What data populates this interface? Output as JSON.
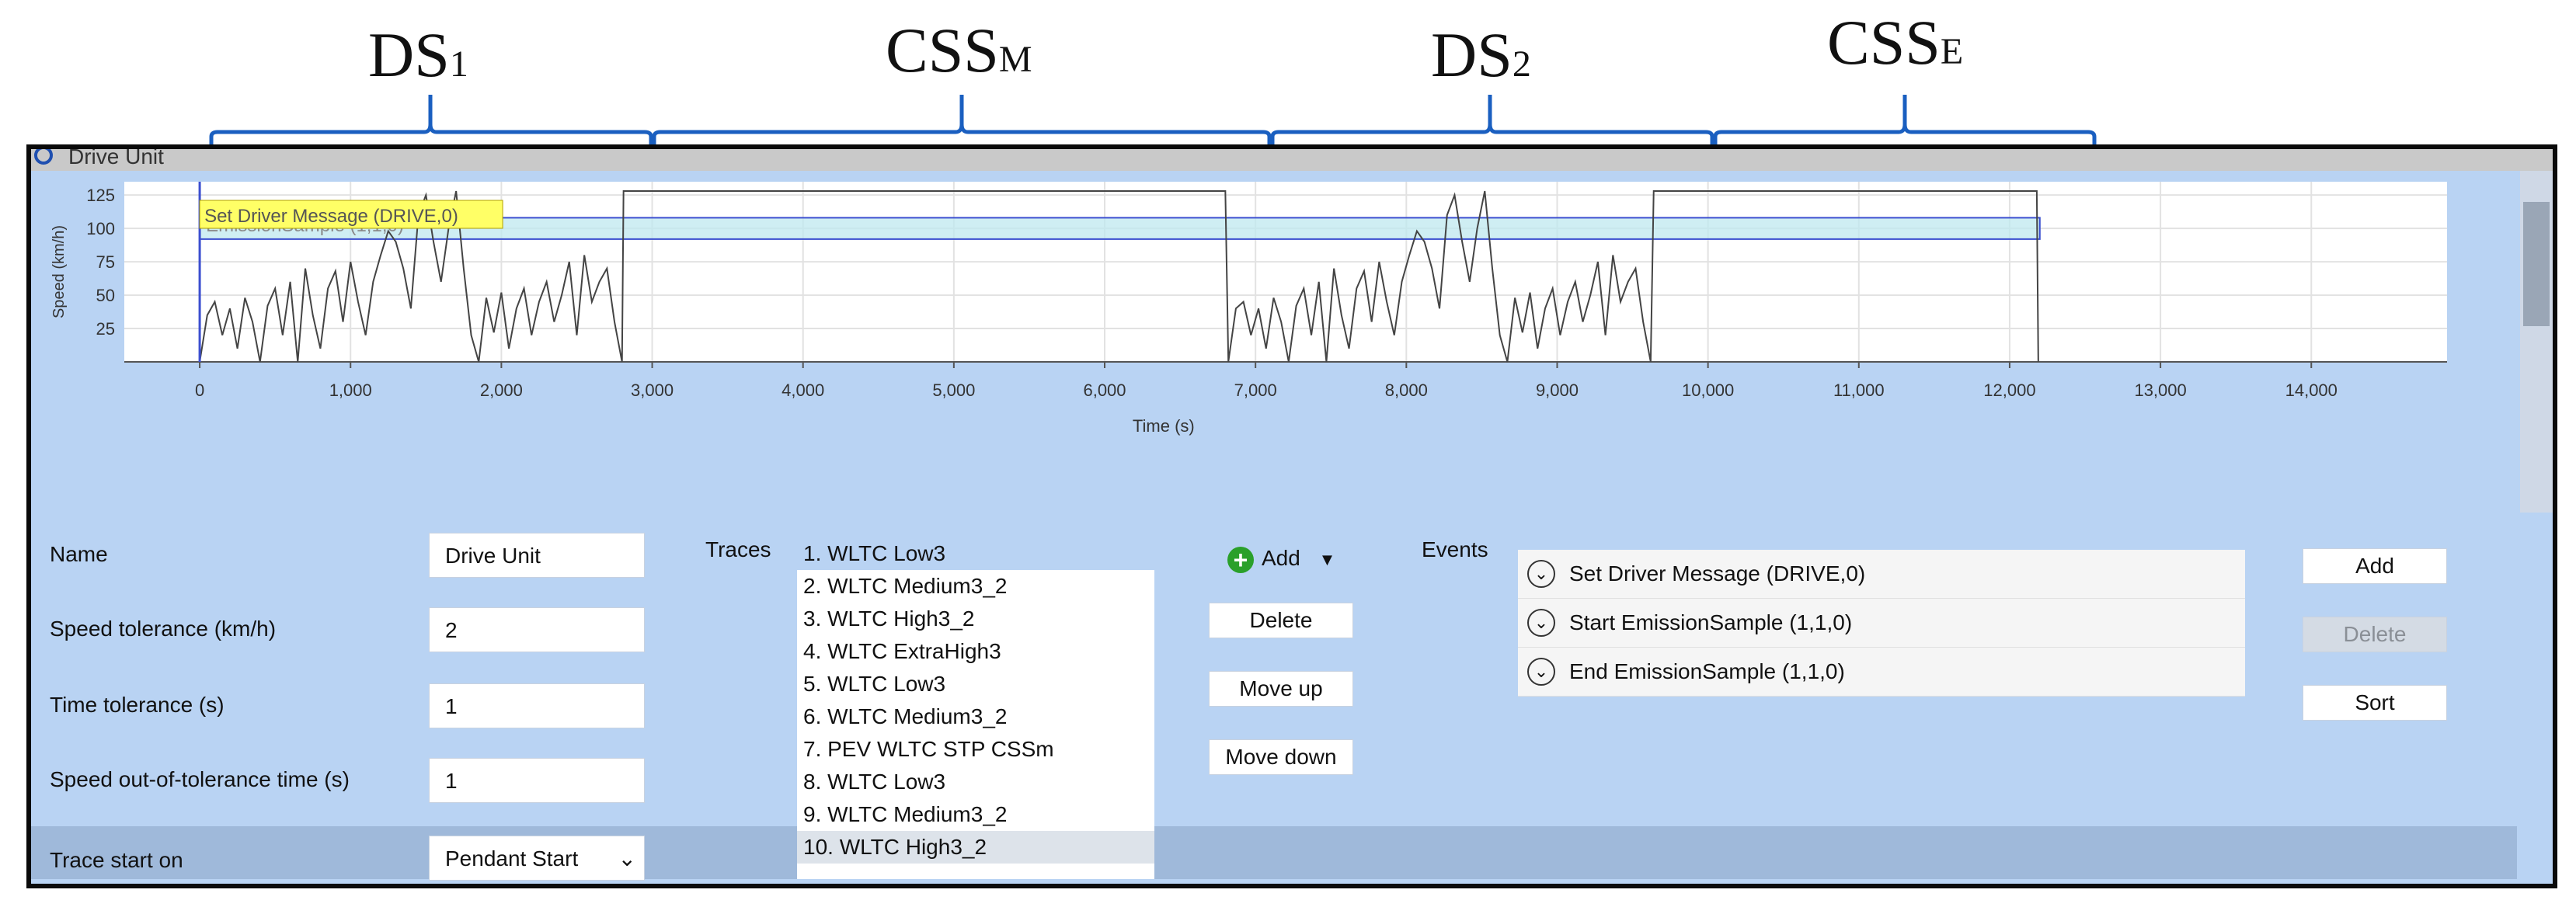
{
  "annotations": {
    "segments": [
      {
        "main": "DS",
        "sub": "1"
      },
      {
        "main": "CSS",
        "sub": "M"
      },
      {
        "main": "DS",
        "sub": "2"
      },
      {
        "main": "CSS",
        "sub": "E"
      }
    ],
    "bracket_color": "#1a5fc0"
  },
  "window": {
    "title": "Drive Unit"
  },
  "chart_data": {
    "type": "line",
    "title": "",
    "xlabel": "Time (s)",
    "ylabel": "Speed (km/h)",
    "xlim": [
      -500,
      14900
    ],
    "ylim": [
      0,
      135
    ],
    "xticks": [
      0,
      1000,
      2000,
      3000,
      4000,
      5000,
      6000,
      7000,
      8000,
      9000,
      10000,
      11000,
      12000,
      13000,
      14000
    ],
    "xtick_labels": [
      "0",
      "1,000",
      "2,000",
      "3,000",
      "4,000",
      "5,000",
      "6,000",
      "7,000",
      "8,000",
      "9,000",
      "10,000",
      "11,000",
      "12,000",
      "13,000",
      "14,000"
    ],
    "yticks": [
      25,
      50,
      75,
      100,
      125
    ],
    "ytick_labels": [
      "25",
      "50",
      "75",
      "100",
      "125"
    ],
    "grid": true,
    "series": [
      {
        "color": "#444444",
        "x": [
          0,
          50,
          100,
          150,
          200,
          250,
          300,
          350,
          400,
          450,
          500,
          550,
          600,
          650,
          700,
          750,
          800,
          850,
          900,
          950,
          1000,
          1050,
          1100,
          1150,
          1200,
          1250,
          1300,
          1350,
          1400,
          1450,
          1500,
          1550,
          1600,
          1650,
          1700,
          1750,
          1800,
          1850,
          1900,
          1950,
          2000,
          2050,
          2100,
          2150,
          2200,
          2250,
          2300,
          2350,
          2400,
          2450,
          2500,
          2550,
          2600,
          2650,
          2700,
          2750,
          2800,
          2810,
          2850,
          6800,
          6820,
          6870,
          6920,
          6970,
          7020,
          7070,
          7120,
          7170,
          7220,
          7270,
          7320,
          7370,
          7420,
          7470,
          7520,
          7570,
          7620,
          7670,
          7720,
          7770,
          7820,
          7870,
          7920,
          7970,
          8020,
          8070,
          8120,
          8170,
          8220,
          8270,
          8320,
          8370,
          8420,
          8470,
          8520,
          8570,
          8620,
          8670,
          8720,
          8770,
          8820,
          8870,
          8920,
          8970,
          9020,
          9070,
          9120,
          9170,
          9220,
          9270,
          9320,
          9370,
          9420,
          9470,
          9520,
          9570,
          9620,
          9640,
          9680,
          12180,
          12190
        ],
        "y": [
          0,
          35,
          45,
          20,
          40,
          10,
          48,
          30,
          0,
          42,
          55,
          20,
          60,
          0,
          70,
          35,
          10,
          55,
          68,
          30,
          75,
          45,
          20,
          60,
          80,
          98,
          90,
          70,
          40,
          110,
          125,
          90,
          60,
          100,
          128,
          70,
          20,
          0,
          48,
          22,
          52,
          10,
          40,
          55,
          20,
          45,
          60,
          30,
          50,
          75,
          20,
          80,
          45,
          60,
          70,
          30,
          0,
          128,
          128,
          128,
          0,
          40,
          45,
          20,
          40,
          10,
          48,
          30,
          0,
          42,
          55,
          20,
          60,
          0,
          70,
          35,
          10,
          55,
          68,
          30,
          75,
          45,
          20,
          60,
          80,
          98,
          90,
          70,
          40,
          110,
          125,
          90,
          60,
          100,
          128,
          70,
          20,
          0,
          48,
          22,
          52,
          10,
          40,
          55,
          20,
          45,
          60,
          30,
          50,
          75,
          20,
          80,
          45,
          60,
          70,
          30,
          0,
          128,
          128,
          128,
          0
        ]
      }
    ],
    "markers": [
      {
        "label": "Set Driver Message (DRIVE,0)",
        "x": 0,
        "color": "#ffff66"
      },
      {
        "label": "EmissionSample (1,1,0)",
        "x_start": 0,
        "x_end": 12200,
        "y_low": 92,
        "y_high": 108,
        "color": "#bfe8ef"
      }
    ]
  },
  "form": {
    "name_label": "Name",
    "name_value": "Drive Unit",
    "speed_tol_label": "Speed tolerance (km/h)",
    "speed_tol_value": "2",
    "time_tol_label": "Time tolerance (s)",
    "time_tol_value": "1",
    "oot_label": "Speed out-of-tolerance time (s)",
    "oot_value": "1",
    "trace_start_label": "Trace start on",
    "trace_start_value": "Pendant Start"
  },
  "traces": {
    "label": "Traces",
    "items": [
      "1. WLTC Low3",
      "2. WLTC Medium3_2",
      "3. WLTC High3_2",
      "4. WLTC ExtraHigh3",
      "5. WLTC Low3",
      "6. WLTC Medium3_2",
      "7. PEV WLTC STP CSSm",
      "8. WLTC Low3",
      "9. WLTC Medium3_2",
      "10. WLTC High3_2"
    ],
    "add_label": "Add",
    "delete_label": "Delete",
    "move_up_label": "Move up",
    "move_down_label": "Move down"
  },
  "events": {
    "label": "Events",
    "items": [
      "Set Driver Message (DRIVE,0)",
      "Start EmissionSample (1,1,0)",
      "End EmissionSample (1,1,0)"
    ],
    "add_label": "Add",
    "delete_label": "Delete",
    "sort_label": "Sort"
  }
}
